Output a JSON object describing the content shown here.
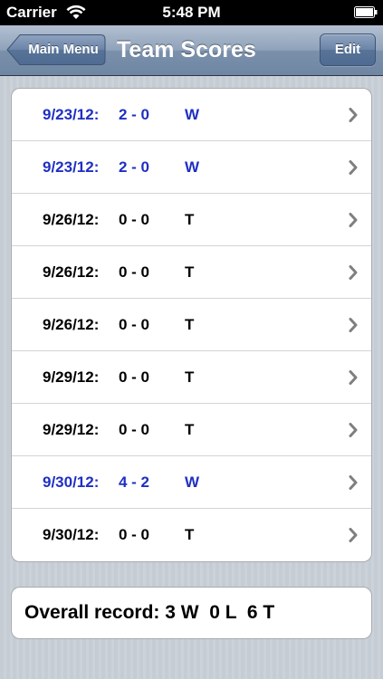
{
  "status_bar": {
    "carrier": "Carrier",
    "time": "5:48 PM"
  },
  "nav": {
    "back_label": "Main Menu",
    "title": "Team Scores",
    "edit_label": "Edit"
  },
  "colors": {
    "win_text": "#1f2fc4",
    "tie_text": "#000000",
    "nav_tint": "#7a90ab"
  },
  "games": [
    {
      "date": "9/23/12:",
      "score": "2 - 0",
      "result": "W"
    },
    {
      "date": "9/23/12:",
      "score": "2 - 0",
      "result": "W"
    },
    {
      "date": "9/26/12:",
      "score": "0 - 0",
      "result": "T"
    },
    {
      "date": "9/26/12:",
      "score": "0 - 0",
      "result": "T"
    },
    {
      "date": "9/26/12:",
      "score": "0 - 0",
      "result": "T"
    },
    {
      "date": "9/29/12:",
      "score": "0 - 0",
      "result": "T"
    },
    {
      "date": "9/29/12:",
      "score": "0 - 0",
      "result": "T"
    },
    {
      "date": "9/30/12:",
      "score": "4 - 2",
      "result": "W"
    },
    {
      "date": "9/30/12:",
      "score": "0 - 0",
      "result": "T"
    }
  ],
  "summary": {
    "text": "Overall record: 3 W  0 L  6 T"
  },
  "icons": {
    "row_accessory": "chevron-right-icon",
    "wifi": "wifi-icon",
    "battery": "battery-icon"
  }
}
